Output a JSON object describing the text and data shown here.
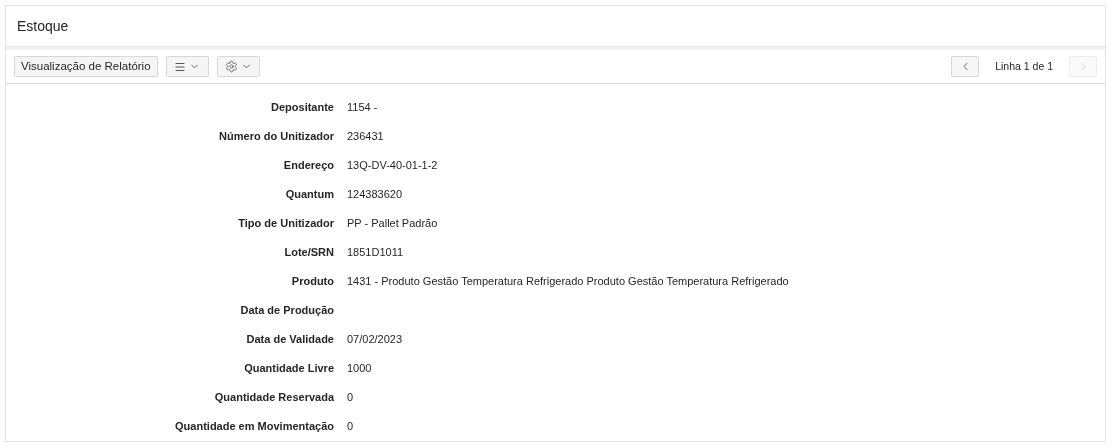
{
  "panel": {
    "title": "Estoque"
  },
  "toolbar": {
    "view_button": "Visualização de Relatório",
    "pagination": {
      "prev": {
        "disabled": false
      },
      "label": "Linha 1 de 1",
      "next": {
        "disabled": true
      }
    }
  },
  "fields": [
    {
      "label": "Depositante",
      "value": "1154 -"
    },
    {
      "label": "Número do Unitizador",
      "value": "236431"
    },
    {
      "label": "Endereço",
      "value": "13Q-DV-40-01-1-2"
    },
    {
      "label": "Quantum",
      "value": "124383620"
    },
    {
      "label": "Tipo de Unitizador",
      "value": "PP - Pallet Padrão"
    },
    {
      "label": "Lote/SRN",
      "value": "1851D1011"
    },
    {
      "label": "Produto",
      "value": "1431 - Produto Gestão Temperatura Refrigerado Produto Gestão Temperatura Refrigerado"
    },
    {
      "label": "Data de Produção"
    },
    {
      "label": "Data de Validade",
      "value": "07/02/2023"
    },
    {
      "label": "Quantidade Livre",
      "value": "1000"
    },
    {
      "label": "Quantidade Reservada",
      "value": "0"
    },
    {
      "label": "Quantidade em Movimentação",
      "value": "0"
    }
  ]
}
